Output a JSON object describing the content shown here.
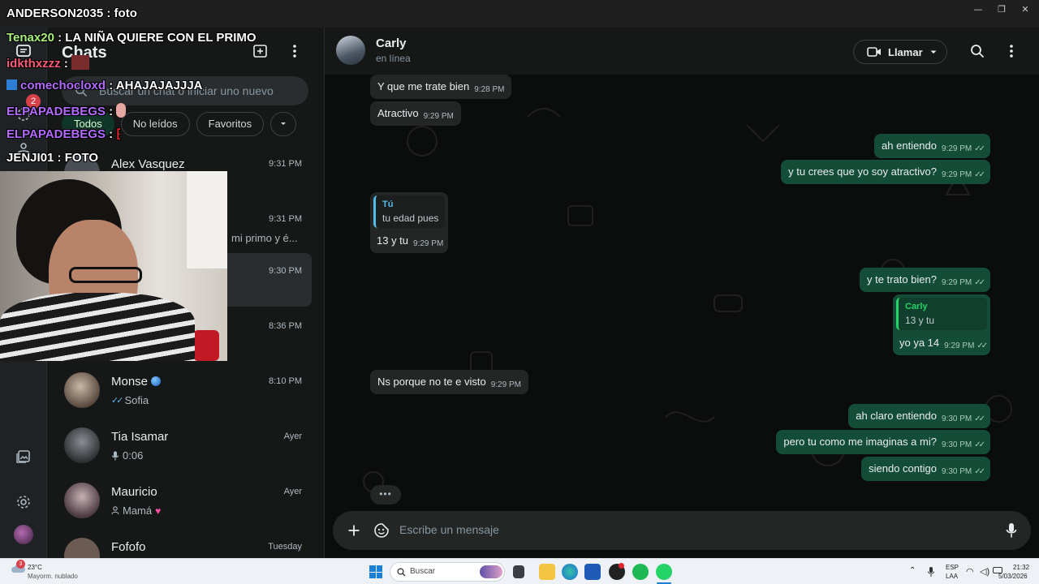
{
  "chat_list": {
    "title": "Chats",
    "search_placeholder": "Buscar un chat o iniciar uno nuevo",
    "filters": [
      "Todos",
      "No leídos",
      "Favoritos"
    ],
    "rail_badge": "2",
    "rows": [
      {
        "name": "Alex Vasquez",
        "time": "9:31 PM",
        "preview": ""
      },
      {
        "name": "",
        "time": "9:31 PM",
        "preview": "mi primo y é..."
      },
      {
        "name": "",
        "time": "9:30 PM",
        "preview": ""
      },
      {
        "name": "",
        "time": "8:36 PM",
        "preview": ""
      },
      {
        "name": "Monse",
        "time": "8:10 PM",
        "preview": "Sofia"
      },
      {
        "name": "Tia Isamar",
        "time": "Ayer",
        "preview": "0:06"
      },
      {
        "name": "Mauricio",
        "time": "Ayer",
        "preview": "Mamá"
      },
      {
        "name": "Fofofo",
        "time": "Tuesday",
        "preview": ""
      }
    ]
  },
  "conversation": {
    "contact_name": "Carly",
    "status": "en línea",
    "call_label": "Llamar",
    "composer_placeholder": "Escribe un mensaje",
    "typing_indicator": "•••",
    "messages": [
      {
        "dir": "in",
        "text": "Y  que me trate bien",
        "time": "9:28 PM"
      },
      {
        "dir": "in",
        "text": "Atractivo",
        "time": "9:29 PM"
      },
      {
        "dir": "out",
        "text": "ah entiendo",
        "time": "9:29 PM"
      },
      {
        "dir": "out",
        "text": "y tu crees que yo soy atractivo?",
        "time": "9:29 PM"
      },
      {
        "dir": "in",
        "quote_author": "Tú",
        "quote_text": "tu edad pues",
        "text": "13 y tu",
        "time": "9:29 PM"
      },
      {
        "dir": "out",
        "text": "y te trato bien?",
        "time": "9:29 PM"
      },
      {
        "dir": "out",
        "quote_author": "Carly",
        "quote_text": "13 y tu",
        "text": "yo ya 14",
        "time": "9:29 PM"
      },
      {
        "dir": "in",
        "text": "Ns porque no te e visto",
        "time": "9:29 PM"
      },
      {
        "dir": "out",
        "text": "ah claro entiendo",
        "time": "9:30 PM"
      },
      {
        "dir": "out",
        "text": "pero tu como me imaginas a mi?",
        "time": "9:30 PM"
      },
      {
        "dir": "out",
        "text": "siendo contigo",
        "time": "9:30 PM"
      }
    ]
  },
  "stream_overlay": [
    {
      "user": "ANDERSON2035",
      "text": " : foto",
      "user_color": "#ffffff"
    },
    {
      "user": "Tenax20",
      "text": " : LA NIÑA QUIERE CON EL PRIMO",
      "user_color": "#a6f27a"
    },
    {
      "user": "idkthxzzz",
      "text": " :",
      "user_color": "#ff5a78"
    },
    {
      "user": "comechocloxd",
      "text": " : AHAJAJAJJJA",
      "user_color": "#b36bff"
    },
    {
      "user": "ELPAPADEBEGS",
      "text": " :",
      "user_color": "#b36bff"
    },
    {
      "user": "ELPAPADEBEGS",
      "text": " :",
      "user_color": "#b36bff"
    },
    {
      "user": "JENJI01",
      "text": " : FOTO",
      "user_color": "#ffffff"
    }
  ],
  "taskbar": {
    "weather_temp": "23°C",
    "weather_desc": "Mayorm. nublado",
    "weather_badge": "3",
    "search_label": "Buscar",
    "lang_top": "ESP",
    "lang_bottom": "LAA",
    "clock_time": "21:32",
    "clock_date": "5/03/2026"
  },
  "colors": {
    "outgoing_bubble": "#144d37",
    "incoming_bubble": "#242626",
    "accent": "#25d366",
    "quote_blue": "#53bdeb"
  }
}
